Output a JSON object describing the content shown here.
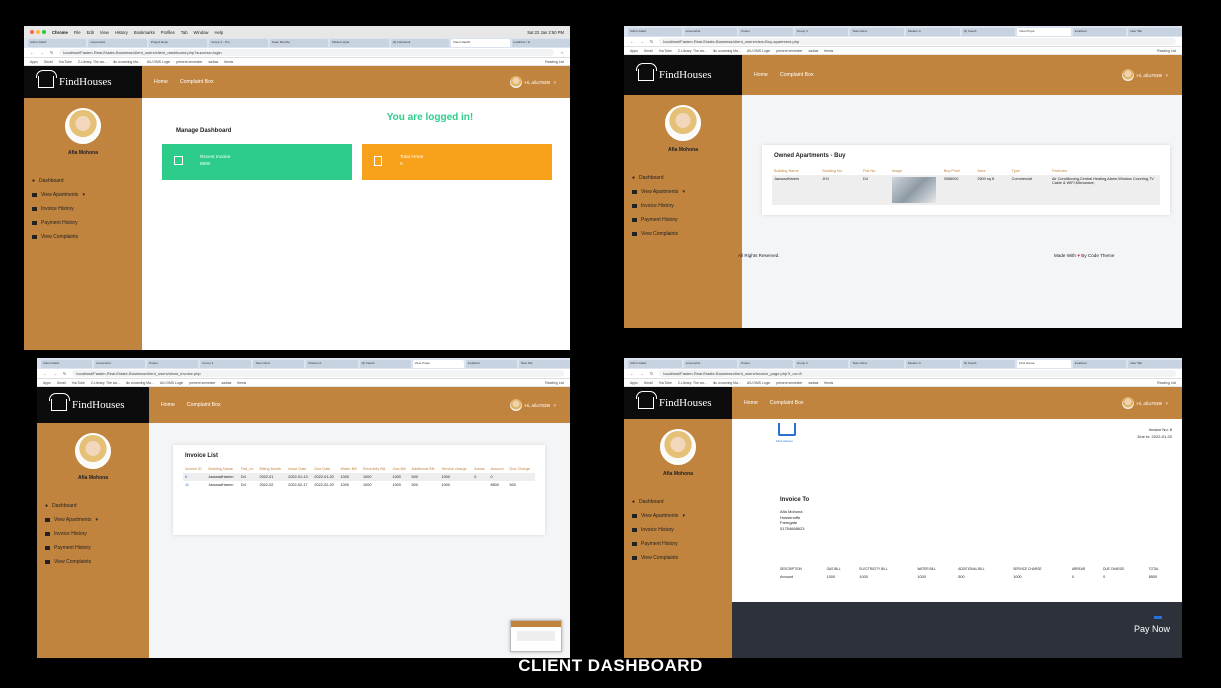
{
  "caption": "CLIENT DASHBOARD",
  "colors": {
    "brand": "#c1843f",
    "dark": "#0c0c0c",
    "green": "#2ecc8a",
    "orange": "#f8a11b",
    "payBar": "#2c313a"
  },
  "common": {
    "logo": "FindHouses",
    "nav_home": "Home",
    "nav_complaint": "Complaint Box",
    "user": "Hi, afia7839!",
    "sidebar_name": "Afia Mohona",
    "sidebar_items": [
      "Dashboard",
      "View Apartments",
      "Invoice History",
      "Payment History",
      "View Complaints"
    ],
    "reading_list": "Reading List",
    "bookmarks": [
      "Apps",
      "Gmail",
      "YouTube",
      "Z-Library. The wo...",
      "iiiu w.saming Ma...",
      "UIU DMS Login",
      "present semester",
      "sadias",
      "thesis"
    ]
  },
  "p1": {
    "mac_menu": [
      "Chrome",
      "File",
      "Edit",
      "View",
      "History",
      "Bookmarks",
      "Profiles",
      "Tab",
      "Window",
      "Help"
    ],
    "clock": "Sat 22 Jan 2:50 PM",
    "tabs": [
      "Admin Dash",
      "screenshot",
      "Project Repo",
      "Group 3 - Pro",
      "Team Membe",
      "Modern Apar",
      "(3) Facebook",
      "Client Dashb",
      "localhost / lo"
    ],
    "url": "localhost/Fasten-Real-Estate-Business/client_users/client_dashboard.php?success=login",
    "headline": "You are logged in!",
    "manage": "Manage Dashboard",
    "recent_label": "Recent Invoice",
    "recent_value": "8500",
    "arrear_label": "Total Arrear",
    "arrear_value": "0"
  },
  "p2": {
    "tabs": [
      "Admin Dash",
      "screenshot",
      "Poster",
      "Group 3",
      "Team Mem",
      "Modern A",
      "(3) Faceb",
      "View Prope",
      "localhost",
      "New Tab"
    ],
    "url": "localhost/Fasten-Real-Estate-Business/client_users/view-Buy-apartment.php",
    "title": "Owned Apartments - Buy",
    "headers": [
      "Building Name",
      "Building No.",
      "Flat No.",
      "Image",
      "Buy Price",
      "Area",
      "Type",
      "Features"
    ],
    "row": [
      "JawwadHarem",
      "JH1",
      "D4",
      "",
      "3956000",
      "2500 sq ft",
      "Commercial",
      "Air Conditioning,Central Heating,Alarm,Window Covering,TV Cable & WIFI,Microwave,"
    ],
    "footer_left": "All Rights Reserved.",
    "footer_right": "Made With",
    "footer_right2": "By Code Theme"
  },
  "p3": {
    "tabs": [
      "Admin Dash",
      "screenshot",
      "Poster",
      "Group 3",
      "Team Mem",
      "Modern A",
      "(3) Faceb",
      "View Prope",
      "localhost",
      "New Tab"
    ],
    "url": "localhost/Fasten-Real-Estate-Business/client_users/show_invoice.php",
    "title": "Invoice List",
    "headers": [
      "Invoice ID",
      "Building Name",
      "Flat_no",
      "Billing Month",
      "Issue Date",
      "Due Date",
      "Water Bill",
      "Electricity Bill",
      "Gas Bill",
      "Additional Bill",
      "Service charge",
      "Arrear",
      "Amount",
      "Due Charge"
    ],
    "rows": [
      [
        "8",
        "JawwadHarem",
        "D4",
        "2022-01",
        "2022-01-13",
        "2022-01-20",
        "1000",
        "1000",
        "1000",
        "500",
        "1000",
        "0",
        "0",
        ""
      ],
      [
        "11",
        "JawwadHarem",
        "D4",
        "2022-02",
        "2022-02-17",
        "2022-02-20",
        "1000",
        "1000",
        "1000",
        "500",
        "1000",
        "",
        "8500",
        "500"
      ]
    ]
  },
  "p4": {
    "tabs": [
      "Admin Dash",
      "screenshot",
      "Poster",
      "Group 3",
      "Team Mem",
      "Modern A",
      "(3) Faceb",
      "Find House",
      "localhost",
      "New Tab"
    ],
    "url": "localhost/Fasten-Real-Estate-Business/client_users/invoice_page.php?i_no=8",
    "logo_caption": "Find Houses",
    "invoice_no": "Invoice No: 8",
    "due": "Due to: 2022-01-20",
    "invoice_to": "Invoice To",
    "name": "Afia Mohona",
    "addr1": "Hossenoffe",
    "addr2": "Farmgate",
    "phone": "01754688623",
    "headers": [
      "DESCRIPTION",
      "GAS BILL",
      "ELECTRICITY BILL",
      "WATER BILL",
      "ADDITIONAL BILL",
      "SERVICE CHARGE",
      "ARREAR",
      "DUE CHARGE",
      "TOTAL"
    ],
    "row": [
      "Amount",
      "1000",
      "1000",
      "1000",
      "500",
      "1000",
      "0",
      "0",
      "8500"
    ],
    "pay": "Pay Now"
  }
}
